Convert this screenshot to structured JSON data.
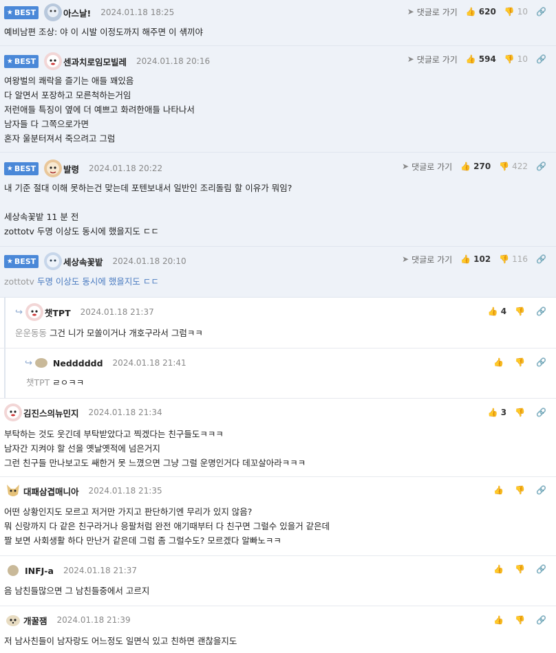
{
  "ui": {
    "best_label": "BEST",
    "reply_to_label": "댓글로 가기"
  },
  "comments": [
    {
      "nick": "아스날!",
      "date": "2024.01.18 18:25",
      "up": "620",
      "down": "10",
      "lines": [
        "예비남편 조상: 야 이 시발 이정도까지 해주면 이 섂끼야"
      ]
    },
    {
      "nick": "센과치로임모빌레",
      "date": "2024.01.18 20:16",
      "up": "594",
      "down": "10",
      "lines": [
        "여왕벌의 쾌락을 즐기는 애들 꽤있음",
        "다 알면서 포장하고 모른척하는거임",
        "저런애들 특징이 옆에 더 예쁘고 화려한애들 나타나서",
        "남자들 다 그쪽으로가면",
        "혼자 울분터져서 죽으려고 그럼"
      ]
    },
    {
      "nick": "발령",
      "date": "2024.01.18 20:22",
      "up": "270",
      "down": "422",
      "lines": [
        "내 기준 절대 이해 못하는건 맞는데 포텐보내서 일반인 조리돌림 할 이유가 뭐임?",
        "",
        "세상속꽃밭 11 분 전",
        "zottotv 두명 이상도 동시에 했을지도 ㄷㄷ"
      ]
    },
    {
      "nick": "세상속꽃밭",
      "date": "2024.01.18 20:10",
      "up": "102",
      "down": "116",
      "tag": "zottotv",
      "text": " 두명 이상도 동시에 했을지도 ㄷㄷ"
    },
    {
      "nick": "챗TPT",
      "date": "2024.01.18 21:37",
      "up": "4",
      "tag": "운운동동",
      "text": " 그건 니가 모쏠이거나 개호구라서 그럼ㅋㅋ"
    },
    {
      "nick": "Nedddddd",
      "date": "2024.01.18 21:41",
      "tag": "챗TPT",
      "text": " ㄹㅇㅋㅋ"
    },
    {
      "nick": "김진스의뉴민지",
      "date": "2024.01.18 21:34",
      "up": "3",
      "lines": [
        "부탁하는 것도 웃긴데 부탁받았다고 찍겠다는 친구들도ㅋㅋㅋ",
        "남자간 지켜야 할 선을 옛날옛적에 넘은거지",
        "그런 친구들 만나보고도 쌔한거 못 느꼈으면 그냥 그럴 운명인거다 데꼬살아라ㅋㅋㅋ"
      ]
    },
    {
      "nick": "대패삼겹매니아",
      "date": "2024.01.18 21:35",
      "lines": [
        "어떤 상황인지도 모르고 저거만 가지고 판단하기엔 무리가 있지 않음?",
        "뭐 신랑까지 다 같은 친구라거나 응팔처럼 완전 애기때부터 다 친구면 그럴수 있을거 같은데",
        "짤 보면 사회생활 하다 만난거 같은데 그럼 좀 그럴수도? 모르겠다 알빠노ㅋㅋ"
      ]
    },
    {
      "nick": "INFJ-a",
      "date": "2024.01.18 21:37",
      "lines": [
        "음 남친들많으면 그 남친들중에서 고르지"
      ]
    },
    {
      "nick": "개꿀잼",
      "date": "2024.01.18 21:39",
      "lines": [
        "저 남사친들이 남자랑도 어느정도 일면식 있고 친하면 괜찮을지도"
      ]
    }
  ]
}
